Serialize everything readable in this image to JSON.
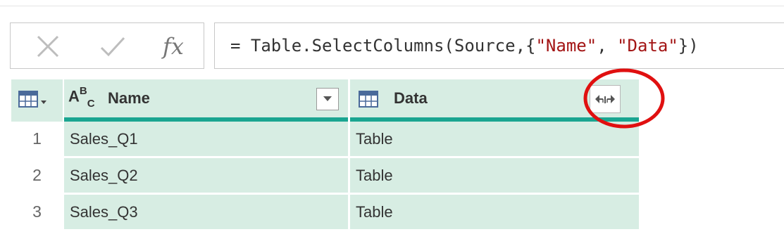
{
  "formula_bar": {
    "cancel_icon": "x-icon",
    "commit_icon": "check-icon",
    "fx_label": "fx",
    "formula_prefix": "= Table.SelectColumns(Source,{",
    "formula_str1": "\"Name\"",
    "formula_mid": ", ",
    "formula_str2": "\"Data\"",
    "formula_suffix": "})"
  },
  "grid": {
    "columns": [
      {
        "name": "Name",
        "type_icon": "abc-text-type-icon",
        "has_dropdown": true
      },
      {
        "name": "Data",
        "type_icon": "table-type-icon",
        "has_expand": true
      }
    ],
    "rows": [
      {
        "index": "1",
        "name": "Sales_Q1",
        "data": "Table"
      },
      {
        "index": "2",
        "name": "Sales_Q2",
        "data": "Table"
      },
      {
        "index": "3",
        "name": "Sales_Q3",
        "data": "Table"
      }
    ]
  },
  "type_label": {
    "a": "A",
    "b": "B",
    "c": "C"
  },
  "colors": {
    "header_bg": "#d7ede3",
    "header_bar": "#1aa591",
    "highlight_circle": "#e01010",
    "string_literal": "#a31515"
  }
}
